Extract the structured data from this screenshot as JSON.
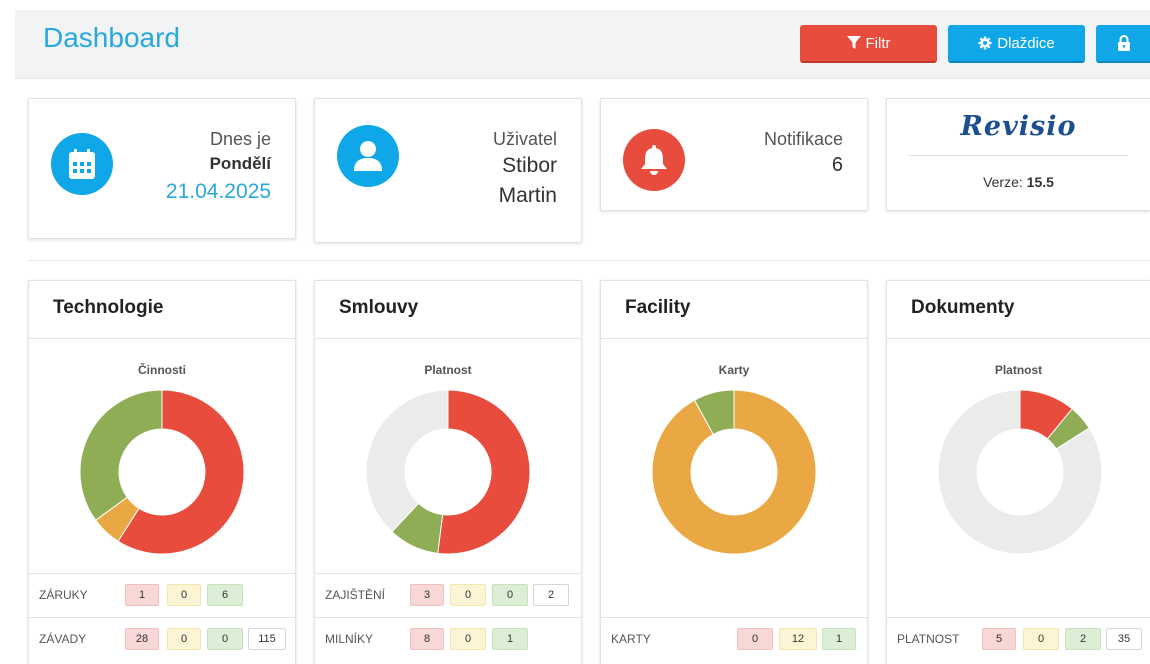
{
  "header": {
    "title": "Dashboard",
    "filter_label": "Filtr",
    "tiles_label": "Dlaždice"
  },
  "info_cards": {
    "date": {
      "label": "Dnes je",
      "day": "Pondělí",
      "date": "21.04.2025"
    },
    "user": {
      "label": "Uživatel",
      "first": "Stibor",
      "last": "Martin"
    },
    "notifications": {
      "label": "Notifikace",
      "count": "6"
    },
    "about": {
      "logo": "Revisio",
      "version_label": "Verze:",
      "version": "15.5"
    }
  },
  "panels": [
    {
      "title": "Technologie",
      "chart_title": "Činnosti",
      "rows": [
        {
          "label": "ZÁRUKY",
          "values": [
            "1",
            "0",
            "6"
          ]
        },
        {
          "label": "ZÁVADY",
          "values": [
            "28",
            "0",
            "0",
            "115"
          ]
        }
      ]
    },
    {
      "title": "Smlouvy",
      "chart_title": "Platnost",
      "rows": [
        {
          "label": "ZAJIŠTĚNÍ",
          "values": [
            "3",
            "0",
            "0",
            "2"
          ]
        },
        {
          "label": "MILNÍKY",
          "values": [
            "8",
            "0",
            "1"
          ]
        }
      ]
    },
    {
      "title": "Facility",
      "chart_title": "Karty",
      "rows": [
        {
          "label": "KARTY",
          "values": [
            "0",
            "12",
            "1"
          ]
        }
      ]
    },
    {
      "title": "Dokumenty",
      "chart_title": "Platnost",
      "rows": [
        {
          "label": "PLATNOST",
          "values": [
            "5",
            "0",
            "2",
            "35"
          ]
        }
      ]
    }
  ],
  "chart_data": [
    {
      "type": "pie",
      "title": "Činnosti",
      "slices": [
        {
          "value": 59,
          "color": "#e74c3c"
        },
        {
          "value": 6,
          "color": "#eaa844"
        },
        {
          "value": 35,
          "color": "#8fad55"
        }
      ]
    },
    {
      "type": "pie",
      "title": "Platnost",
      "slices": [
        {
          "value": 52,
          "color": "#e74c3c"
        },
        {
          "value": 10,
          "color": "#8fad55"
        },
        {
          "value": 38,
          "color": "#ebebeb"
        }
      ]
    },
    {
      "type": "pie",
      "title": "Karty",
      "slices": [
        {
          "value": 92,
          "color": "#eaa844"
        },
        {
          "value": 8,
          "color": "#8fad55"
        }
      ]
    },
    {
      "type": "pie",
      "title": "Platnost",
      "slices": [
        {
          "value": 11,
          "color": "#e74c3c"
        },
        {
          "value": 5,
          "color": "#8fad55"
        },
        {
          "value": 84,
          "color": "#ebebeb"
        }
      ]
    }
  ],
  "colors": {
    "accent": "#29a8dd",
    "danger": "#e74c3c",
    "primary_button": "#10a7e8",
    "calendar_icon_bg": "#10a7e8",
    "user_icon_bg": "#10a7e8",
    "bell_icon_bg": "#e74c3c"
  },
  "icons": {
    "filter": "filter-icon",
    "tiles": "gear-icon",
    "lock": "lock-icon",
    "calendar": "calendar-icon",
    "user": "user-icon",
    "bell": "bell-icon"
  }
}
